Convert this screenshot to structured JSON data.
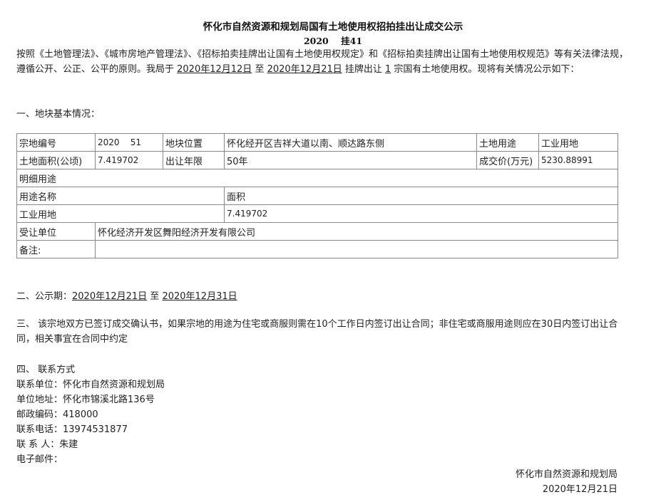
{
  "title": "怀化市自然资源和规划局国有土地使用权招拍挂出让成交公示",
  "subtitle": "2020    挂41",
  "intro": {
    "p1": "按照《土地管理法》、《城市房地产管理法》、《招标拍卖挂牌出让国有土地使用权规定》和《招标拍卖挂牌出让国有土地使用权规范》等有关法律法规，遵循公开、公正、公平的原则。我局于 ",
    "start_date": "2020年12月12日",
    "p2": " 至 ",
    "end_date": "2020年12月21日",
    "p3": " 挂牌出让 ",
    "count": "1",
    "p4": " 宗国有土地使用权。现将有关情况公示如下："
  },
  "section1": "一、地块基本情况：",
  "table": {
    "r1": [
      "宗地编号",
      "2020    51",
      "地块位置",
      "怀化经开区吉祥大道以南、顺达路东侧",
      "土地用途",
      "工业用地"
    ],
    "r2": [
      "土地面积(公顷)",
      "7.419702",
      "出让年限",
      "50年",
      "成交价(万元)",
      "5230.88991"
    ],
    "detail_label": "明细用途",
    "use_name_label": "用途名称",
    "area_label": "面积",
    "use_name_value": "工业用地",
    "area_value": "7.419702",
    "buyer_label": "受让单位",
    "buyer_value": "怀化经济开发区舞阳经济开发有限公司",
    "remark_label": "备注:",
    "remark_value": ""
  },
  "section2": {
    "prefix": "二、公示期：",
    "start": "2020年12月21日",
    "mid": " 至 ",
    "end": "2020年12月31日"
  },
  "section3": "三、 该宗地双方已签订成交确认书，如果宗地的用途为住宅或商服则需在10个工作日内签订出让合同；非住宅或商服用途则应在30日内签订出让合同，相关事宜在合同中约定",
  "section4": {
    "heading": "四、 联系方式",
    "unit": "联系单位：怀化市自然资源和规划局",
    "address": "单位地址：怀化市锦溪北路136号",
    "postcode": "邮政编码：418000",
    "phone": "联系电话：13974531877",
    "contact": "联 系 人：朱建",
    "email": "电子邮件："
  },
  "footer": {
    "org": "怀化市自然资源和规划局",
    "date": "2020年12月21日"
  }
}
